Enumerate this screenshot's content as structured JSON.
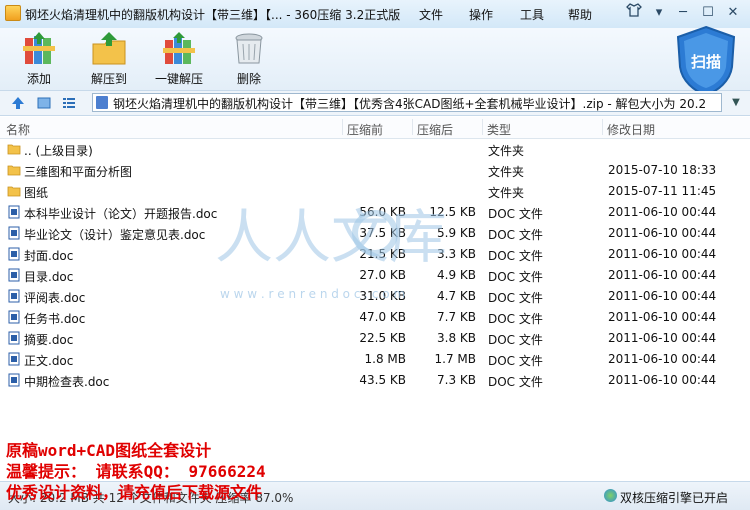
{
  "titlebar": {
    "title": "钢坯火焰清理机中的翻版机构设计【带三维】【... - 360压缩 3.2正式版",
    "menus": [
      "文件",
      "操作",
      "工具",
      "帮助"
    ]
  },
  "toolbar": {
    "buttons": [
      {
        "label": "添加",
        "icon": "add-books-icon"
      },
      {
        "label": "解压到",
        "icon": "extract-to-icon"
      },
      {
        "label": "一键解压",
        "icon": "one-click-extract-icon"
      },
      {
        "label": "删除",
        "icon": "trash-can-icon"
      }
    ],
    "scan_label": "扫描"
  },
  "address": {
    "path": "钢坯火焰清理机中的翻版机构设计【带三维】【优秀含4张CAD图纸+全套机械毕业设计】.zip - 解包大小为 20.2"
  },
  "columns": {
    "name": "名称",
    "size": "压缩前",
    "packed": "压缩后",
    "type": "类型",
    "modified": "修改日期"
  },
  "files": [
    {
      "name": ".. (上级目录)",
      "size": "",
      "packed": "",
      "type": "文件夹",
      "date": "",
      "kind": "folder"
    },
    {
      "name": "三维图和平面分析图",
      "size": "",
      "packed": "",
      "type": "文件夹",
      "date": "2015-07-10 18:33",
      "kind": "folder"
    },
    {
      "name": "图纸",
      "size": "",
      "packed": "",
      "type": "文件夹",
      "date": "2015-07-11 11:45",
      "kind": "folder"
    },
    {
      "name": "本科毕业设计（论文）开题报告.doc",
      "size": "56.0 KB",
      "packed": "12.5 KB",
      "type": "DOC 文件",
      "date": "2011-06-10 00:44",
      "kind": "doc"
    },
    {
      "name": "毕业论文（设计）鉴定意见表.doc",
      "size": "37.5 KB",
      "packed": "5.9 KB",
      "type": "DOC 文件",
      "date": "2011-06-10 00:44",
      "kind": "doc"
    },
    {
      "name": "封面.doc",
      "size": "21.5 KB",
      "packed": "3.3 KB",
      "type": "DOC 文件",
      "date": "2011-06-10 00:44",
      "kind": "doc"
    },
    {
      "name": "目录.doc",
      "size": "27.0 KB",
      "packed": "4.9 KB",
      "type": "DOC 文件",
      "date": "2011-06-10 00:44",
      "kind": "doc"
    },
    {
      "name": "评阅表.doc",
      "size": "31.0 KB",
      "packed": "4.7 KB",
      "type": "DOC 文件",
      "date": "2011-06-10 00:44",
      "kind": "doc"
    },
    {
      "name": "任务书.doc",
      "size": "47.0 KB",
      "packed": "7.7 KB",
      "type": "DOC 文件",
      "date": "2011-06-10 00:44",
      "kind": "doc"
    },
    {
      "name": "摘要.doc",
      "size": "22.5 KB",
      "packed": "3.8 KB",
      "type": "DOC 文件",
      "date": "2011-06-10 00:44",
      "kind": "doc"
    },
    {
      "name": "正文.doc",
      "size": "1.8 MB",
      "packed": "1.7 MB",
      "type": "DOC 文件",
      "date": "2011-06-10 00:44",
      "kind": "doc"
    },
    {
      "name": "中期检查表.doc",
      "size": "43.5 KB",
      "packed": "7.3 KB",
      "type": "DOC 文件",
      "date": "2011-06-10 00:44",
      "kind": "doc"
    }
  ],
  "watermark": {
    "text": "人人文库",
    "url": "w w w . r e n r e n d o c . c o m"
  },
  "status": {
    "left": "大小: 20.2 MB 共 12 个文件和文件夹 压缩率 87.0%",
    "engine": "双核压缩引擎已开启"
  },
  "overlay": {
    "line1": "原稿word+CAD图纸全套设计",
    "line2": "温馨提示： 请联系QQ： 97666224",
    "line3": "优秀设计资料，请充值后下载源文件"
  },
  "colors": {
    "overlay_red": "#e00000",
    "accent_blue": "#2c7bd4",
    "folder_yellow": "#f3c24a"
  }
}
